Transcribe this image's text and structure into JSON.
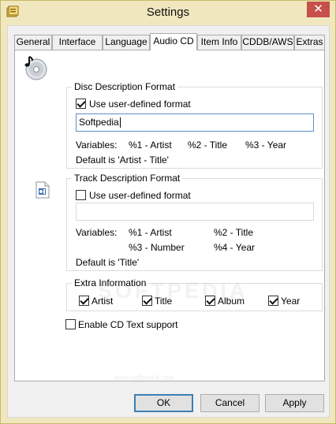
{
  "window": {
    "title": "Settings",
    "close_glyph": "✕"
  },
  "tabs": [
    {
      "label": "General"
    },
    {
      "label": "Interface"
    },
    {
      "label": "Language"
    },
    {
      "label": "Audio CD"
    },
    {
      "label": "Item Info"
    },
    {
      "label": "CDDB/AWS"
    },
    {
      "label": "Extras"
    }
  ],
  "active_tab": "Audio CD",
  "disc_format": {
    "group_title": "Disc Description Format",
    "use_custom_label": "Use user-defined format",
    "use_custom_checked": true,
    "value": "Softpedia",
    "variables_label": "Variables:",
    "vars": [
      "%1 - Artist",
      "%2 - Title",
      "%3 - Year"
    ],
    "default_text": "Default is 'Artist - Title'"
  },
  "track_format": {
    "group_title": "Track Description Format",
    "use_custom_label": "Use user-defined format",
    "use_custom_checked": false,
    "value": "",
    "variables_label": "Variables:",
    "vars": [
      "%1 - Artist",
      "%2 - Title",
      "%3 - Number",
      "%4 - Year"
    ],
    "default_text": "Default is 'Title'"
  },
  "extra_info": {
    "group_title": "Extra Information",
    "items": [
      {
        "label": "Artist",
        "checked": true
      },
      {
        "label": "Title",
        "checked": true
      },
      {
        "label": "Album",
        "checked": true
      },
      {
        "label": "Year",
        "checked": true
      }
    ]
  },
  "cd_text": {
    "label": "Enable CD Text support",
    "checked": false
  },
  "buttons": {
    "ok": "OK",
    "cancel": "Cancel",
    "apply": "Apply"
  },
  "watermark": {
    "brand": "SOFTPEDIA",
    "url": "www.softpedia.com"
  },
  "colors": {
    "frame": "#f0e7be",
    "close": "#c7504a",
    "accent": "#3c7fb1"
  }
}
